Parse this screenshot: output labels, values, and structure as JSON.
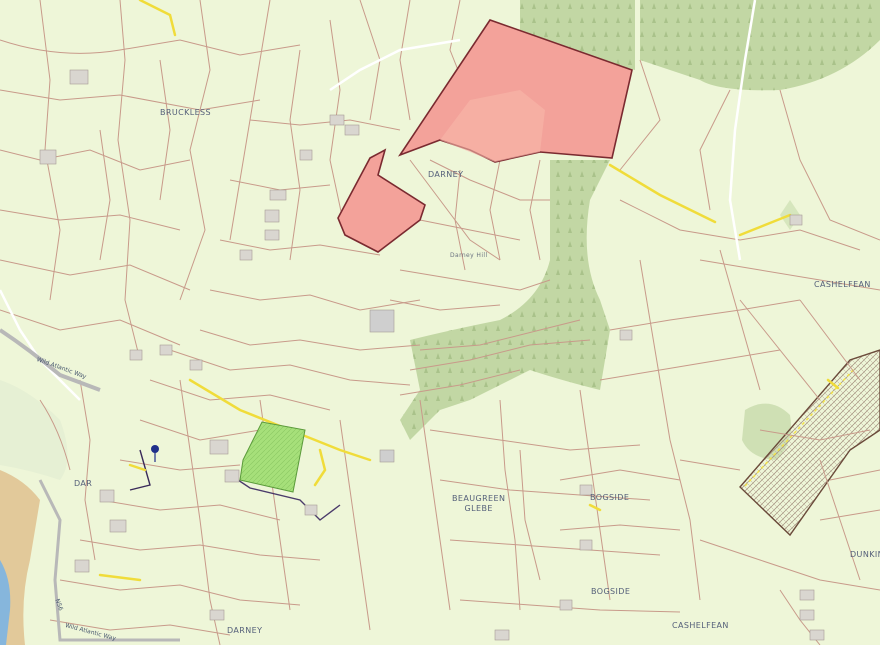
{
  "map": {
    "place_labels": [
      {
        "id": "bruckless",
        "text": "BRUCKLESS"
      },
      {
        "id": "darney-top",
        "text": "DARNEY"
      },
      {
        "id": "darney-hill",
        "text": "Darney Hill"
      },
      {
        "id": "cashelfean-right",
        "text": "CASHELFEAN"
      },
      {
        "id": "dar-left",
        "text": "DAR"
      },
      {
        "id": "beaugreen",
        "text": "BEAUGREEN\nGLEBE"
      },
      {
        "id": "bogside-1",
        "text": "BOGSIDE"
      },
      {
        "id": "bogside-2",
        "text": "BOGSIDE"
      },
      {
        "id": "cashelfean-bottom",
        "text": "CASHELFEAN"
      },
      {
        "id": "darney-bottom",
        "text": "DARNEY"
      },
      {
        "id": "dunkin",
        "text": "DUNKIN"
      }
    ],
    "road_labels": [
      {
        "id": "wild-atlantic-1",
        "text": "Wild Atlantic Way"
      },
      {
        "id": "wild-atlantic-2",
        "text": "Wild Atlantic Way"
      },
      {
        "id": "n56",
        "text": "N56"
      }
    ],
    "colors": {
      "background": "#eef6d8",
      "field_boundary": "#c89a8a",
      "forestry": "#c5d8a8",
      "highlight_parcel": "#f3a29a",
      "highlight_parcel_border": "#7a2a30",
      "road_minor": "#f2e24a",
      "green_parcel": "#a6e07a",
      "water": "#7fb0d8",
      "coast": "#d9b88a"
    },
    "marker": {
      "icon": "location-pin-icon",
      "color": "#1f2f8a"
    }
  }
}
